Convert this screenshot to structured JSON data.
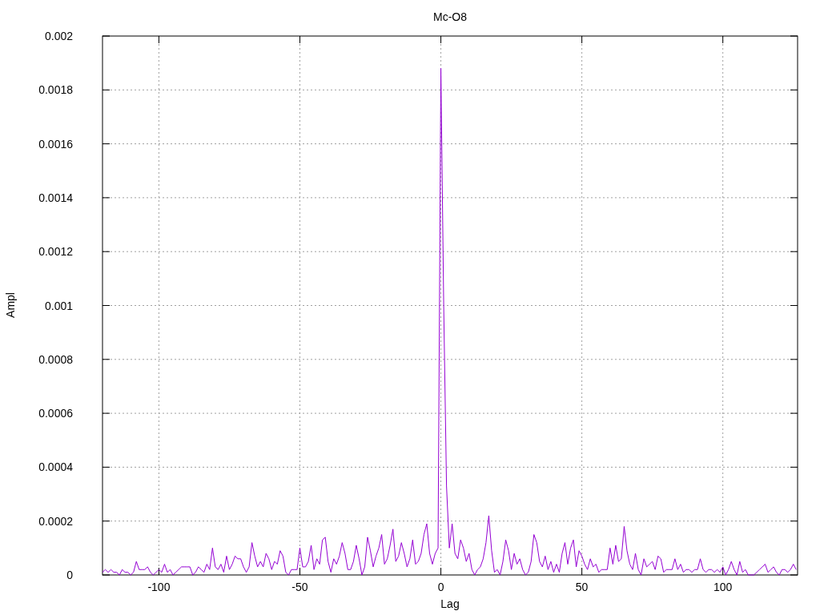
{
  "chart_data": {
    "type": "line",
    "grid": true,
    "title": "Mc-O8",
    "xlabel": "Lag",
    "ylabel": "Ampl",
    "xlim": [
      -120,
      126.5
    ],
    "ylim": [
      0,
      0.002
    ],
    "xticks": [
      -100,
      -50,
      0,
      50,
      100
    ],
    "yticks": [
      {
        "value": 0,
        "label": "0"
      },
      {
        "value": 0.0002,
        "label": "0.0002"
      },
      {
        "value": 0.0004,
        "label": "0.0004"
      },
      {
        "value": 0.0006,
        "label": "0.0006"
      },
      {
        "value": 0.0008,
        "label": "0.0008"
      },
      {
        "value": 0.001,
        "label": "0.001"
      },
      {
        "value": 0.0012,
        "label": "0.0012"
      },
      {
        "value": 0.0014,
        "label": "0.0014"
      },
      {
        "value": 0.0016,
        "label": "0.0016"
      },
      {
        "value": 0.0018,
        "label": "0.0018"
      },
      {
        "value": 0.002,
        "label": "0.002"
      }
    ],
    "x": [
      -120,
      -119,
      -118,
      -117,
      -116,
      -115,
      -114,
      -113,
      -112,
      -111,
      -110,
      -109,
      -108,
      -107,
      -106,
      -105,
      -104,
      -103,
      -102,
      -101,
      -100,
      -99,
      -98,
      -97,
      -96,
      -95,
      -94,
      -93,
      -92,
      -91,
      -90,
      -89,
      -88,
      -87,
      -86,
      -85,
      -84,
      -83,
      -82,
      -81,
      -80,
      -79,
      -78,
      -77,
      -76,
      -75,
      -74,
      -73,
      -72,
      -71,
      -70,
      -69,
      -68,
      -67,
      -66,
      -65,
      -64,
      -63,
      -62,
      -61,
      -60,
      -59,
      -58,
      -57,
      -56,
      -55,
      -54,
      -53,
      -52,
      -51,
      -50,
      -49,
      -48,
      -47,
      -46,
      -45,
      -44,
      -43,
      -42,
      -41,
      -40,
      -39,
      -38,
      -37,
      -36,
      -35,
      -34,
      -33,
      -32,
      -31,
      -30,
      -29,
      -28,
      -27,
      -26,
      -25,
      -24,
      -23,
      -22,
      -21,
      -20,
      -19,
      -18,
      -17,
      -16,
      -15,
      -14,
      -13,
      -12,
      -11,
      -10,
      -9,
      -8,
      -7,
      -6,
      -5,
      -4,
      -3,
      -2,
      -1,
      0,
      1,
      2,
      3,
      4,
      5,
      6,
      7,
      8,
      9,
      10,
      11,
      12,
      13,
      14,
      15,
      16,
      17,
      18,
      19,
      20,
      21,
      22,
      23,
      24,
      25,
      26,
      27,
      28,
      29,
      30,
      31,
      32,
      33,
      34,
      35,
      36,
      37,
      38,
      39,
      40,
      41,
      42,
      43,
      44,
      45,
      46,
      47,
      48,
      49,
      50,
      51,
      52,
      53,
      54,
      55,
      56,
      57,
      58,
      59,
      60,
      61,
      62,
      63,
      64,
      65,
      66,
      67,
      68,
      69,
      70,
      71,
      72,
      73,
      74,
      75,
      76,
      77,
      78,
      79,
      80,
      81,
      82,
      83,
      84,
      85,
      86,
      87,
      88,
      89,
      90,
      91,
      92,
      93,
      94,
      95,
      96,
      97,
      98,
      99,
      100,
      101,
      102,
      103,
      104,
      105,
      106,
      107,
      108,
      109,
      110,
      111,
      112,
      113,
      114,
      115,
      116,
      117,
      118,
      119,
      120,
      121,
      122,
      123,
      124,
      125,
      126
    ],
    "series": [
      {
        "color": "#9400d3",
        "values": [
          1e-05,
          2e-05,
          1e-05,
          2e-05,
          1e-05,
          1e-05,
          0,
          2e-05,
          1e-05,
          1e-05,
          0,
          1e-05,
          5e-05,
          2e-05,
          2e-05,
          2e-05,
          3e-05,
          1e-05,
          0,
          1e-05,
          2e-05,
          1e-05,
          4e-05,
          1e-05,
          2e-05,
          0,
          1e-05,
          2e-05,
          3e-05,
          3e-05,
          3e-05,
          3e-05,
          0,
          1e-05,
          3e-05,
          2e-05,
          1e-05,
          4e-05,
          2e-05,
          0.0001,
          3e-05,
          2e-05,
          4e-05,
          1e-05,
          7e-05,
          2e-05,
          4e-05,
          7e-05,
          6e-05,
          6e-05,
          3e-05,
          1e-05,
          3e-05,
          0.00012,
          7e-05,
          3e-05,
          5e-05,
          3e-05,
          8e-05,
          6e-05,
          2e-05,
          5e-05,
          4e-05,
          9e-05,
          7e-05,
          1e-05,
          0,
          2e-05,
          2e-05,
          2e-05,
          0.0001,
          3e-05,
          3e-05,
          5e-05,
          0.00011,
          2e-05,
          6e-05,
          4e-05,
          0.00013,
          0.00014,
          5e-05,
          1e-05,
          6e-05,
          4e-05,
          7e-05,
          0.00012,
          8e-05,
          2e-05,
          2e-05,
          5e-05,
          0.00011,
          6e-05,
          0,
          3e-05,
          0.00014,
          9e-05,
          3e-05,
          7e-05,
          0.0001,
          0.00015,
          4e-05,
          6e-05,
          0.00011,
          0.00017,
          5e-05,
          7e-05,
          0.00012,
          8e-05,
          3e-05,
          6e-05,
          0.00013,
          4e-05,
          5e-05,
          8e-05,
          0.00015,
          0.00019,
          8e-05,
          4e-05,
          8e-05,
          0.0001,
          0.00188,
          0.001,
          0.00033,
          0.0001,
          0.00019,
          8e-05,
          6e-05,
          0.00013,
          0.0001,
          5e-05,
          8e-05,
          2e-05,
          0,
          2e-05,
          3e-05,
          6e-05,
          0.00012,
          0.00022,
          9e-05,
          1e-05,
          2e-05,
          0,
          5e-05,
          0.00013,
          9e-05,
          2e-05,
          8e-05,
          4e-05,
          6e-05,
          2e-05,
          0,
          1e-05,
          5e-05,
          0.00015,
          0.00012,
          5e-05,
          3e-05,
          7e-05,
          2e-05,
          5e-05,
          1e-05,
          4e-05,
          1e-05,
          8e-05,
          0.00012,
          4e-05,
          0.0001,
          0.00013,
          3e-05,
          9e-05,
          7e-05,
          4e-05,
          2e-05,
          6e-05,
          3e-05,
          4e-05,
          1e-05,
          2e-05,
          2e-05,
          2e-05,
          0.0001,
          4e-05,
          0.00011,
          5e-05,
          6e-05,
          0.00018,
          9e-05,
          4e-05,
          2e-05,
          8e-05,
          2e-05,
          0,
          6e-05,
          3e-05,
          4e-05,
          5e-05,
          2e-05,
          7e-05,
          6e-05,
          1e-05,
          2e-05,
          2e-05,
          2e-05,
          6e-05,
          2e-05,
          4e-05,
          1e-05,
          2e-05,
          2e-05,
          1e-05,
          2e-05,
          2e-05,
          6e-05,
          2e-05,
          1e-05,
          2e-05,
          2e-05,
          1e-05,
          2e-05,
          1e-05,
          3e-05,
          0,
          2e-05,
          5e-05,
          2e-05,
          0,
          5e-05,
          1e-05,
          2e-05,
          0,
          0,
          0,
          1e-05,
          2e-05,
          3e-05,
          4e-05,
          1e-05,
          2e-05,
          3e-05,
          1e-05,
          0,
          2e-05,
          2e-05,
          1e-05,
          2e-05,
          4e-05,
          2e-05
        ]
      }
    ]
  }
}
